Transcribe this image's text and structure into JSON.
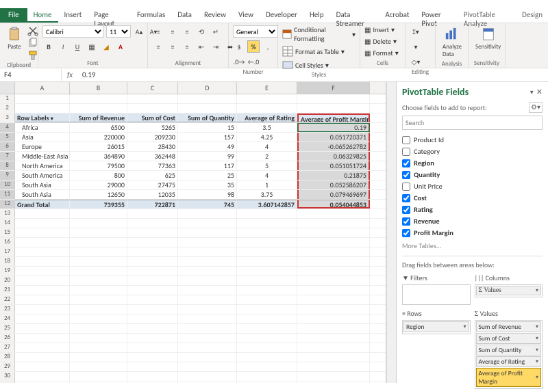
{
  "menubar": {
    "file": "File",
    "tabs": [
      "Home",
      "Insert",
      "Page Layout",
      "Formulas",
      "Data",
      "Review",
      "View",
      "Developer",
      "Help",
      "Data Streamer",
      "Acrobat",
      "Power Pivot"
    ],
    "active": 0,
    "context": [
      "PivotTable Analyze",
      "Design"
    ]
  },
  "ribbon": {
    "clipboard": {
      "paste": "Paste",
      "label": "Clipboard"
    },
    "font": {
      "name": "Calibri",
      "size": "11",
      "label": "Font"
    },
    "alignment": {
      "label": "Alignment"
    },
    "number": {
      "format": "General",
      "label": "Number"
    },
    "styles": {
      "cf": "Conditional Formatting",
      "tbl": "Format as Table",
      "cs": "Cell Styles",
      "label": "Styles"
    },
    "cells": {
      "ins": "Insert",
      "del": "Delete",
      "fmt": "Format",
      "label": "Cells"
    },
    "editing": {
      "label": "Editing"
    },
    "analysis": {
      "btn": "Analyze\nData",
      "label": "Analysis"
    },
    "sens": {
      "btn": "Sensitivity",
      "label": "Sensitivity"
    }
  },
  "namebox": {
    "ref": "F4",
    "formula": "0.19"
  },
  "columns": [
    "A",
    "B",
    "C",
    "D",
    "E",
    "F"
  ],
  "chart_data": {
    "type": "table",
    "title": "PivotTable",
    "headers": [
      "Row Labels",
      "Sum of Revenue",
      "Sum of Cost",
      "Sum of Quantity",
      "Average of Rating",
      "Average of Profit Margin"
    ],
    "rows": [
      {
        "label": "Africa",
        "rev": "6500",
        "cost": "5265",
        "qty": "15",
        "rating": "3.5",
        "pm": "0.19"
      },
      {
        "label": "Asia",
        "rev": "220000",
        "cost": "209230",
        "qty": "157",
        "rating": "4.25",
        "pm": "0.051720371"
      },
      {
        "label": "Europe",
        "rev": "26015",
        "cost": "28430",
        "qty": "49",
        "rating": "4",
        "pm": "-0.065262782"
      },
      {
        "label": "Middle-East Asia",
        "rev": "364890",
        "cost": "362448",
        "qty": "99",
        "rating": "2",
        "pm": "0.06329825"
      },
      {
        "label": "North America",
        "rev": "79500",
        "cost": "77363",
        "qty": "117",
        "rating": "5",
        "pm": "0.051051724"
      },
      {
        "label": "South America",
        "rev": "800",
        "cost": "625",
        "qty": "25",
        "rating": "4",
        "pm": "0.21875"
      },
      {
        "label": "South Asia",
        "rev": "29000",
        "cost": "27475",
        "qty": "35",
        "rating": "1",
        "pm": "0.052586207"
      },
      {
        "label": "South Asia",
        "rev": "12650",
        "cost": "12035",
        "qty": "98",
        "rating": "3.75",
        "pm": "0.079469697"
      }
    ],
    "grand_total": {
      "label": "Grand Total",
      "rev": "739355",
      "cost": "722871",
      "qty": "745",
      "rating": "3.607142857",
      "pm": "0.054044853"
    }
  },
  "fields_pane": {
    "title": "PivotTable Fields",
    "subtitle": "Choose fields to add to report:",
    "search_ph": "Search",
    "fields": [
      {
        "name": "Product Id",
        "checked": false
      },
      {
        "name": "Category",
        "checked": false
      },
      {
        "name": "Region",
        "checked": true
      },
      {
        "name": "Quantity",
        "checked": true
      },
      {
        "name": "Unit Price",
        "checked": false
      },
      {
        "name": "Cost",
        "checked": true
      },
      {
        "name": "Rating",
        "checked": true
      },
      {
        "name": "Revenue",
        "checked": true
      },
      {
        "name": "Profit Margin",
        "checked": true
      }
    ],
    "more": "More Tables...",
    "drag": "Drag fields between areas below:",
    "filters_label": "Filters",
    "columns_label": "Columns",
    "rows_label": "Rows",
    "values_label": "Values",
    "columns_items": [
      "Σ Values"
    ],
    "rows_items": [
      "Region"
    ],
    "values_items": [
      "Sum of Revenue",
      "Sum of Cost",
      "Sum of Quantity",
      "Average of Rating",
      "Average of Profit Margin"
    ]
  }
}
